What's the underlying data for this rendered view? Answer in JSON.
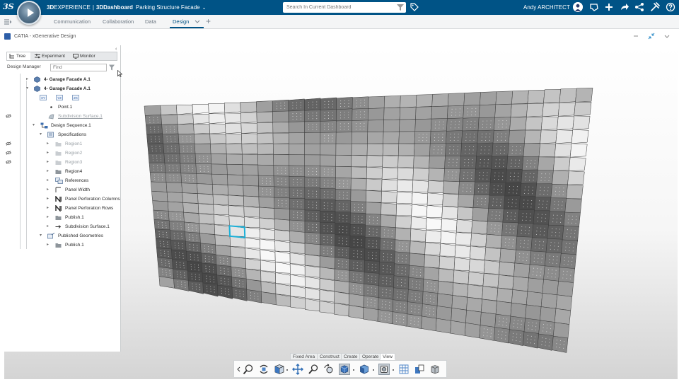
{
  "topbar": {
    "logo": "3S",
    "brand_bold": "3D",
    "brand_rest": "EXPERIENCE",
    "separator": "|",
    "dashboard": "3DDashboard",
    "title": "Parking Structure Facade",
    "title_chevron": "chevron-down-icon",
    "search_placeholder": "Search In Current Dashboard",
    "user": "Andy ARCHITECT",
    "icons": [
      "tag-icon",
      "chat-icon",
      "plus-icon",
      "share-icon",
      "network-icon",
      "tools-icon",
      "help-icon"
    ]
  },
  "tabs": [
    {
      "label": "Communication",
      "active": false
    },
    {
      "label": "Collaboration",
      "active": false
    },
    {
      "label": "Data",
      "active": false
    },
    {
      "label": "Design",
      "active": true
    }
  ],
  "app": {
    "title": "CATIA - xGenerative Design"
  },
  "panel": {
    "tabs": [
      {
        "label": "Tree",
        "icon": "tree-icon",
        "active": true
      },
      {
        "label": "Experiment",
        "icon": "sliders-icon",
        "active": false
      },
      {
        "label": "Monitor",
        "icon": "monitor-icon",
        "active": false
      }
    ],
    "design_manager_label": "Design Manager",
    "find_placeholder": "Find"
  },
  "tree": [
    {
      "label": "4- Garage Facade A.1",
      "bold": true
    },
    {
      "label": "4- Garage Facade A.1",
      "bold": true
    },
    {
      "sub": [
        "XY",
        "YZ",
        "ZX"
      ]
    },
    {
      "label": "Point.1"
    },
    {
      "label": "Subdivision Surface.1",
      "style": "link"
    },
    {
      "label": "Design Sequence.1"
    },
    {
      "label": "Specifications"
    },
    {
      "label": "Region1",
      "style": "dim"
    },
    {
      "label": "Region2",
      "style": "dim"
    },
    {
      "label": "Region3",
      "style": "dim"
    },
    {
      "label": "Region4"
    },
    {
      "label": "References"
    },
    {
      "label": "Panel Width"
    },
    {
      "label": "Panel Perforation Columns"
    },
    {
      "label": "Panel Perforation Rows"
    },
    {
      "label": "Publish.1"
    },
    {
      "label": "Subdivision Surface.1"
    },
    {
      "label": "Published Geometries"
    },
    {
      "label": "Publish.1"
    }
  ],
  "command_tabs": [
    {
      "label": "Fixed Area",
      "active": false
    },
    {
      "label": "Construct",
      "active": false
    },
    {
      "label": "Create",
      "active": false
    },
    {
      "label": "Operate",
      "active": false
    },
    {
      "label": "View",
      "active": true
    }
  ],
  "command_icons": [
    "zoom-fit-icon",
    "pan-rotate-icon",
    "view-cube-icon",
    "move-icon",
    "zoom-icon",
    "rotate-icon",
    "iso-view-icon",
    "shading-icon",
    "render-style-icon",
    "grid-icon",
    "tile-icon",
    "box-icon"
  ],
  "colors": {
    "topbar": "#005386",
    "accent": "#005386",
    "selection": "#1ab0d8"
  }
}
